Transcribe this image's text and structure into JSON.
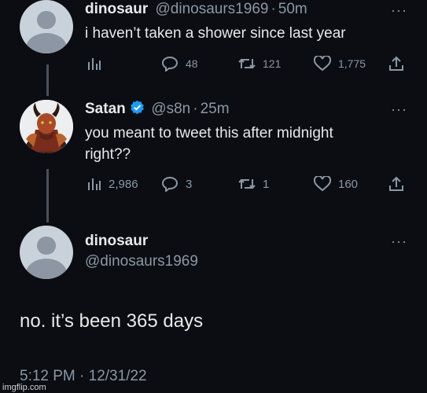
{
  "tweets": [
    {
      "name": "dinosaur",
      "handle": "@dinosaurs1969",
      "separator": "·",
      "time": "50m",
      "text": "i haven’t taken a shower since last year",
      "stats": {
        "views": "",
        "replies": "48",
        "retweets": "121",
        "likes": "1,775"
      }
    },
    {
      "name": "Satan",
      "handle": "@s8n",
      "separator": "·",
      "time": "25m",
      "text_line1": "you meant to tweet this after midnight",
      "text_line2": "right??",
      "stats": {
        "views": "2,986",
        "replies": "3",
        "retweets": "1",
        "likes": "160"
      }
    }
  ],
  "main_tweet": {
    "name": "dinosaur",
    "handle": "@dinosaurs1969",
    "text": "no. it’s been 365 days",
    "timestamp": "5:12 PM · 12/31/22"
  },
  "more_label": "···",
  "watermark": "imgflip.com",
  "colors": {
    "background": "#0b0d12",
    "text": "#e7e9ea",
    "muted": "#8b98a5",
    "verified": "#1d9bf0"
  }
}
